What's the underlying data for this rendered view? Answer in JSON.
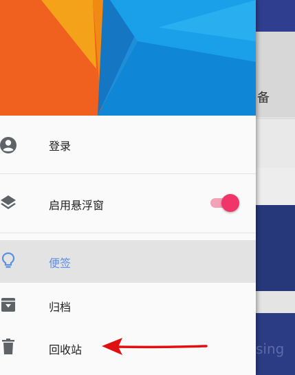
{
  "background": {
    "card_text_partial": "备",
    "blue_card_text_partial": "sing"
  },
  "drawer": {
    "items": [
      {
        "label": "登录",
        "icon": "account-circle-icon"
      },
      {
        "label": "启用悬浮窗",
        "icon": "layers-icon",
        "toggle_on": true
      },
      {
        "label": "便签",
        "icon": "lightbulb-icon",
        "selected": true
      },
      {
        "label": "归档",
        "icon": "archive-icon"
      },
      {
        "label": "回收站",
        "icon": "trash-icon"
      }
    ]
  },
  "colors": {
    "accent_selected": "#5c8fe6",
    "toggle_thumb": "#f0356b",
    "toggle_track": "#f3a3b8",
    "annotation_arrow": "#e01010"
  }
}
